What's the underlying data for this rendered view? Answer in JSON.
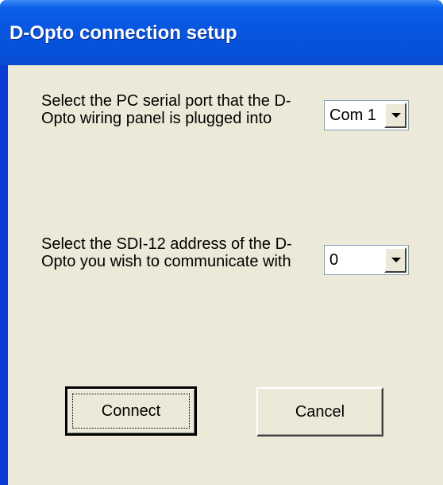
{
  "window": {
    "title": "D-Opto connection setup"
  },
  "port_section": {
    "label": "Select the PC serial port that the D-Opto wiring panel is plugged into",
    "selected_value": "Com 1"
  },
  "address_section": {
    "label": "Select the SDI-12 address of the D-Opto you wish to communicate with",
    "selected_value": "0"
  },
  "buttons": {
    "connect_label": "Connect",
    "cancel_label": "Cancel"
  },
  "colors": {
    "titlebar": "#0650d8",
    "dialog_background": "#ece9d8"
  },
  "icons": {
    "dropdown": "chevron-down-icon"
  }
}
